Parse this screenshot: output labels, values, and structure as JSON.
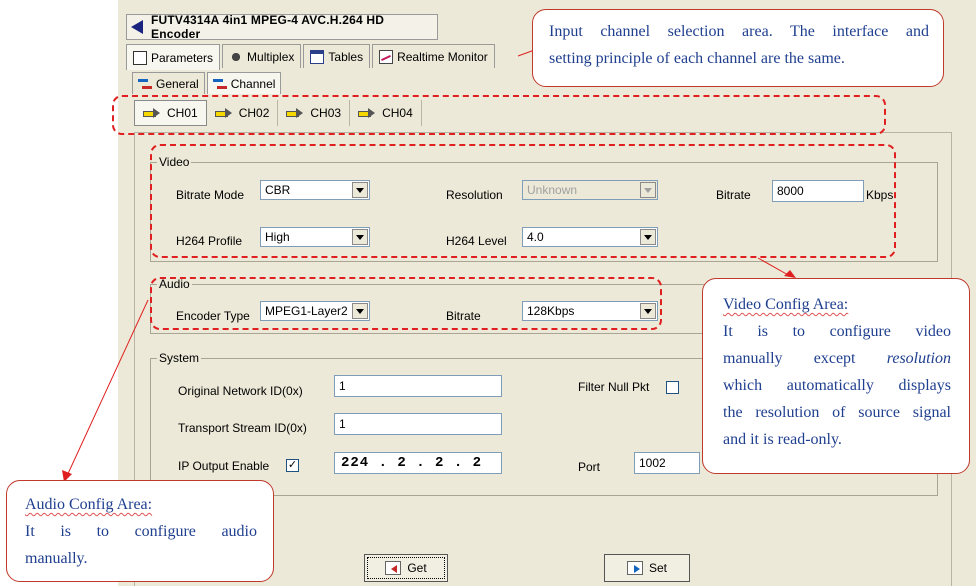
{
  "window": {
    "title": "FUTV4314A 4in1 MPEG-4 AVC.H.264 HD Encoder",
    "tabs": [
      {
        "label": "Parameters",
        "icon": "parameters-icon"
      },
      {
        "label": "Multiplex",
        "icon": "multiplex-icon"
      },
      {
        "label": "Tables",
        "icon": "tables-icon"
      },
      {
        "label": "Realtime Monitor",
        "icon": "monitor-icon"
      }
    ],
    "subtabs": [
      {
        "label": "General"
      },
      {
        "label": "Channel"
      }
    ],
    "channels": [
      "CH01",
      "CH02",
      "CH03",
      "CH04"
    ],
    "active_channel": "CH01"
  },
  "video": {
    "group_title": "Video",
    "bitrate_mode_label": "Bitrate Mode",
    "bitrate_mode_value": "CBR",
    "resolution_label": "Resolution",
    "resolution_value": "Unknown",
    "bitrate_label": "Bitrate",
    "bitrate_value": "8000",
    "bitrate_unit": "Kbps",
    "h264_profile_label": "H264 Profile",
    "h264_profile_value": "High",
    "h264_level_label": "H264 Level",
    "h264_level_value": "4.0"
  },
  "audio": {
    "group_title": "Audio",
    "encoder_type_label": "Encoder Type",
    "encoder_type_value": "MPEG1-Layer2",
    "bitrate_label": "Bitrate",
    "bitrate_value": "128Kbps"
  },
  "system": {
    "group_title": "System",
    "onid_label": "Original Network ID(0x)",
    "onid_value": "1",
    "tsid_label": "Transport Stream ID(0x)",
    "tsid_value": "1",
    "ip_output_label": "IP Output Enable",
    "ip_output_checked": "✓",
    "ip_value": "224 . 2 . 2 . 2",
    "port_label": "Port",
    "port_value": "1002",
    "filter_null_label": "Filter Null Pkt"
  },
  "buttons": {
    "get_label": "Get",
    "set_label": "Set"
  },
  "callouts": {
    "input_channel": {
      "line1": "Input channel selection area. The interface and",
      "line2": "setting principle of each channel are the same."
    },
    "video": {
      "title": "Video Config Area:",
      "line1": "It is to configure video",
      "line2a": "manually except ",
      "line2b": "resolution",
      "line3": "which automatically displays",
      "line4": "the resolution of source signal",
      "line5": "and it is read-only."
    },
    "audio": {
      "title": "Audio Config Area:",
      "line1": "It is to configure audio",
      "line2": "manually."
    }
  },
  "colors": {
    "highlight": "#e02020",
    "callout_text": "#1f3f8f",
    "window_bg": "#ece9d8"
  }
}
